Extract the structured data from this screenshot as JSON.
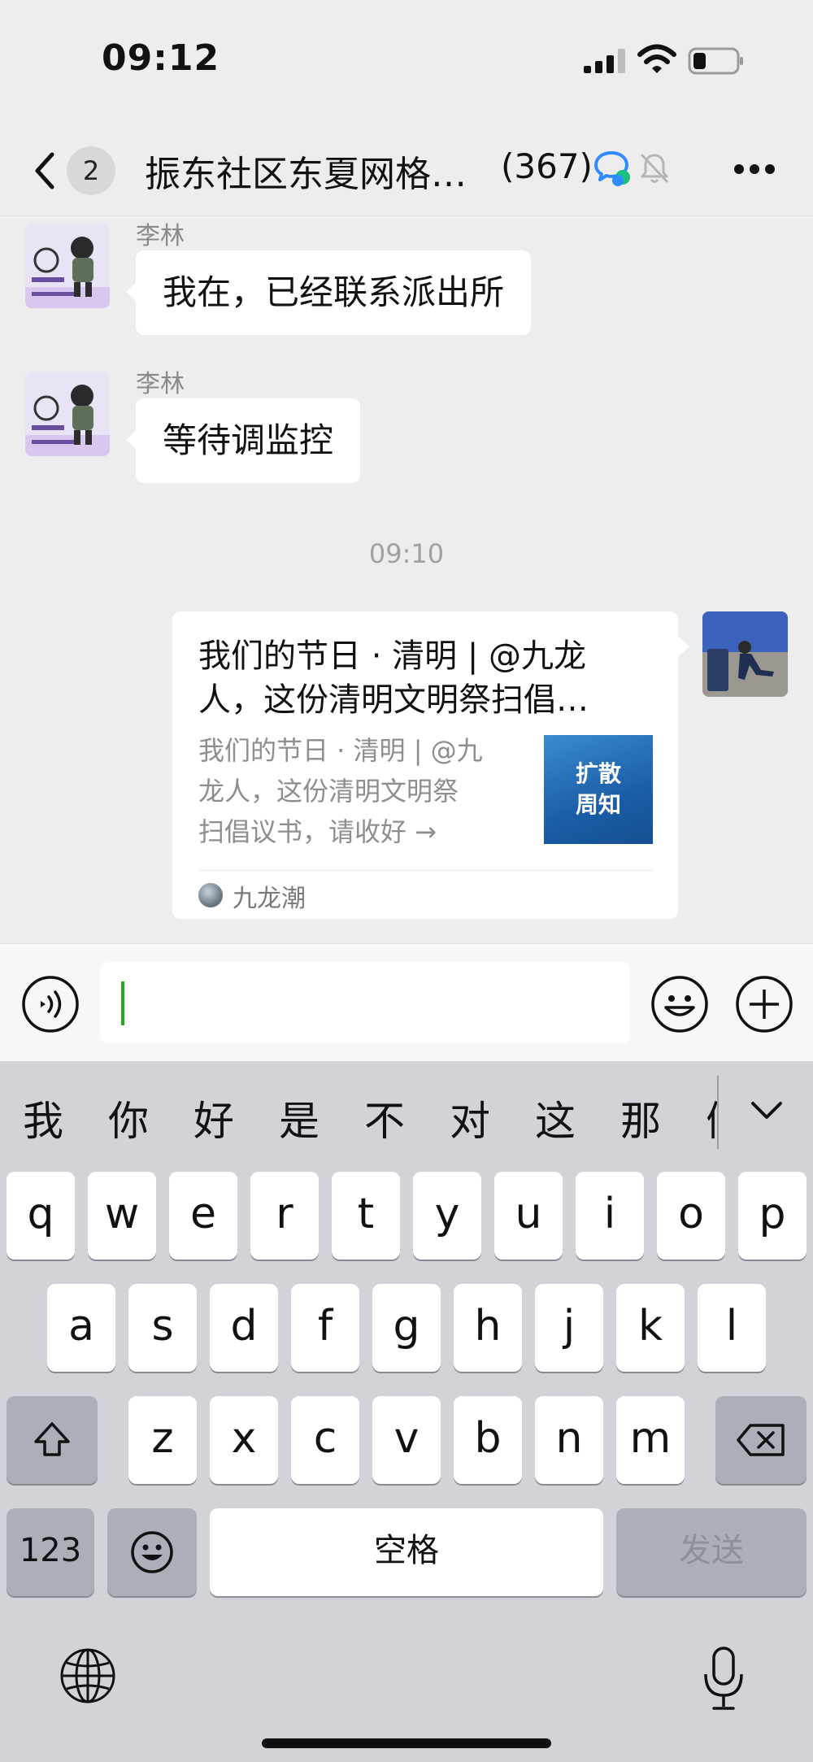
{
  "status_bar": {
    "time": "09:12"
  },
  "header": {
    "unread_count": "2",
    "title": "振东社区东夏网格…",
    "member_count": "(367)"
  },
  "messages": [
    {
      "sender": "李林",
      "text": "我在，已经联系派出所"
    },
    {
      "sender": "李林",
      "text": "等待调监控"
    }
  ],
  "timestamp": "09:10",
  "article_card": {
    "title_line1": "我们的节日 · 清明 | @九龙",
    "title_line2": "人，这份清明文明祭扫倡…",
    "desc_line1": "我们的节日 · 清明 | @九",
    "desc_line2": "龙人，这份清明文明祭",
    "desc_line3": "扫倡议书，请收好 →",
    "thumb_line1": "扩散",
    "thumb_line2": "周知",
    "source": "九龙潮"
  },
  "keyboard": {
    "candidates": [
      "我",
      "你",
      "好",
      "是",
      "不",
      "对",
      "这",
      "那",
      "们"
    ],
    "row1": [
      "q",
      "w",
      "e",
      "r",
      "t",
      "y",
      "u",
      "i",
      "o",
      "p"
    ],
    "row2": [
      "a",
      "s",
      "d",
      "f",
      "g",
      "h",
      "j",
      "k",
      "l"
    ],
    "row3": [
      "z",
      "x",
      "c",
      "v",
      "b",
      "n",
      "m"
    ],
    "numbers_label": "123",
    "space_label": "空格",
    "send_label": "发送"
  },
  "icons": {
    "back": "chevron-left-icon",
    "group": "chat-bubbles-icon",
    "mute": "bell-off-icon",
    "more": "ellipsis-icon",
    "voice": "voice-icon",
    "emoji": "emoji-icon",
    "plus": "plus-icon",
    "shift": "shift-icon",
    "delete": "backspace-icon",
    "globe": "globe-icon",
    "mic": "mic-icon"
  },
  "colors": {
    "caret": "#1aad19",
    "group_icon_blue": "#2f8cff",
    "group_icon_green": "#19c27a"
  }
}
